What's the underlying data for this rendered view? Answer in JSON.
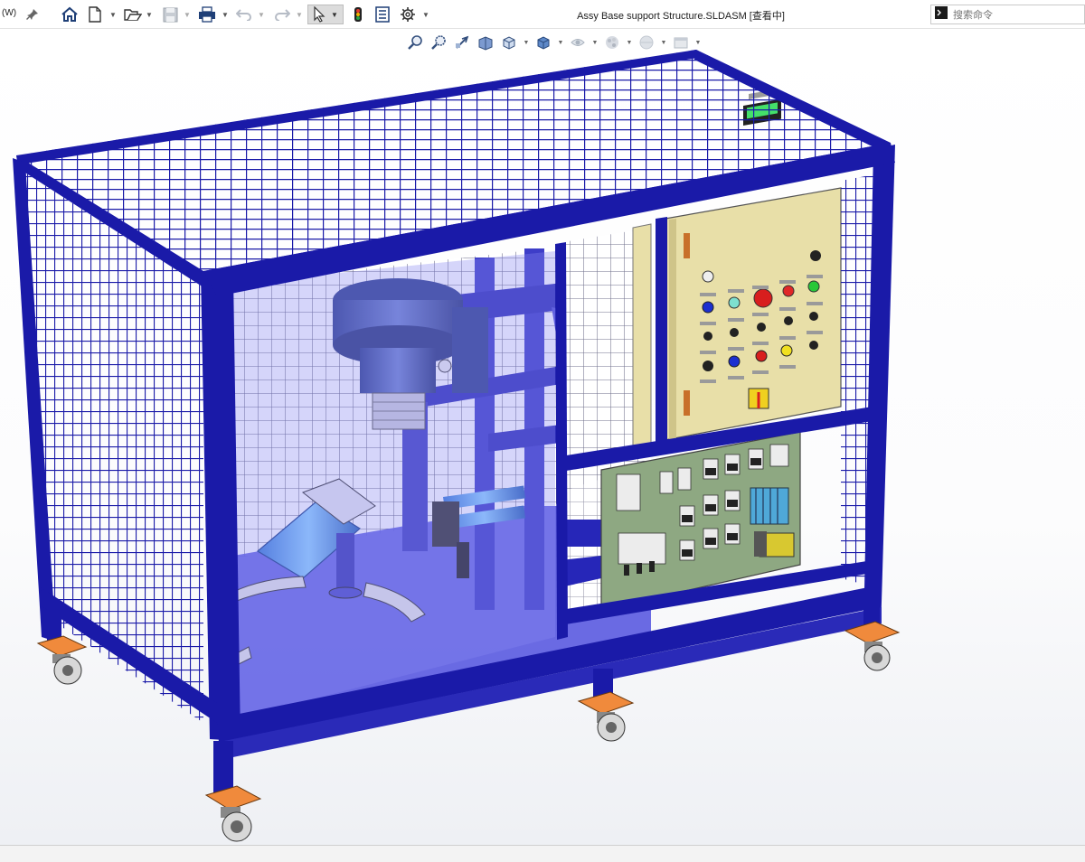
{
  "titlebar": {
    "menu_stub": "(W)",
    "document_title": "Assy Base support Structure.SLDASM [查看中]",
    "search_placeholder": "搜索命令"
  },
  "toolbar": {
    "buttons": [
      "pin-icon",
      "home-icon",
      "new-document-icon",
      "open-icon",
      "save-icon",
      "print-icon",
      "undo-icon",
      "redo-icon",
      "select-icon",
      "traffic-light-icon",
      "file-properties-icon",
      "options-icon"
    ]
  },
  "heads_up_toolbar": {
    "buttons": [
      "zoom-to-fit-icon",
      "zoom-to-area-icon",
      "previous-view-icon",
      "section-view-icon",
      "view-orientation-icon",
      "display-style-icon",
      "hide-show-items-icon",
      "edit-appearance-icon",
      "apply-scene-icon",
      "view-settings-icon"
    ]
  },
  "colors": {
    "frame_blue": "#1a1aa8",
    "glass_blue": "#7a7ae6",
    "panel_beige": "#e8dfa8",
    "pneumatic_green": "#8ea882",
    "caster_orange": "#f08a3c"
  }
}
